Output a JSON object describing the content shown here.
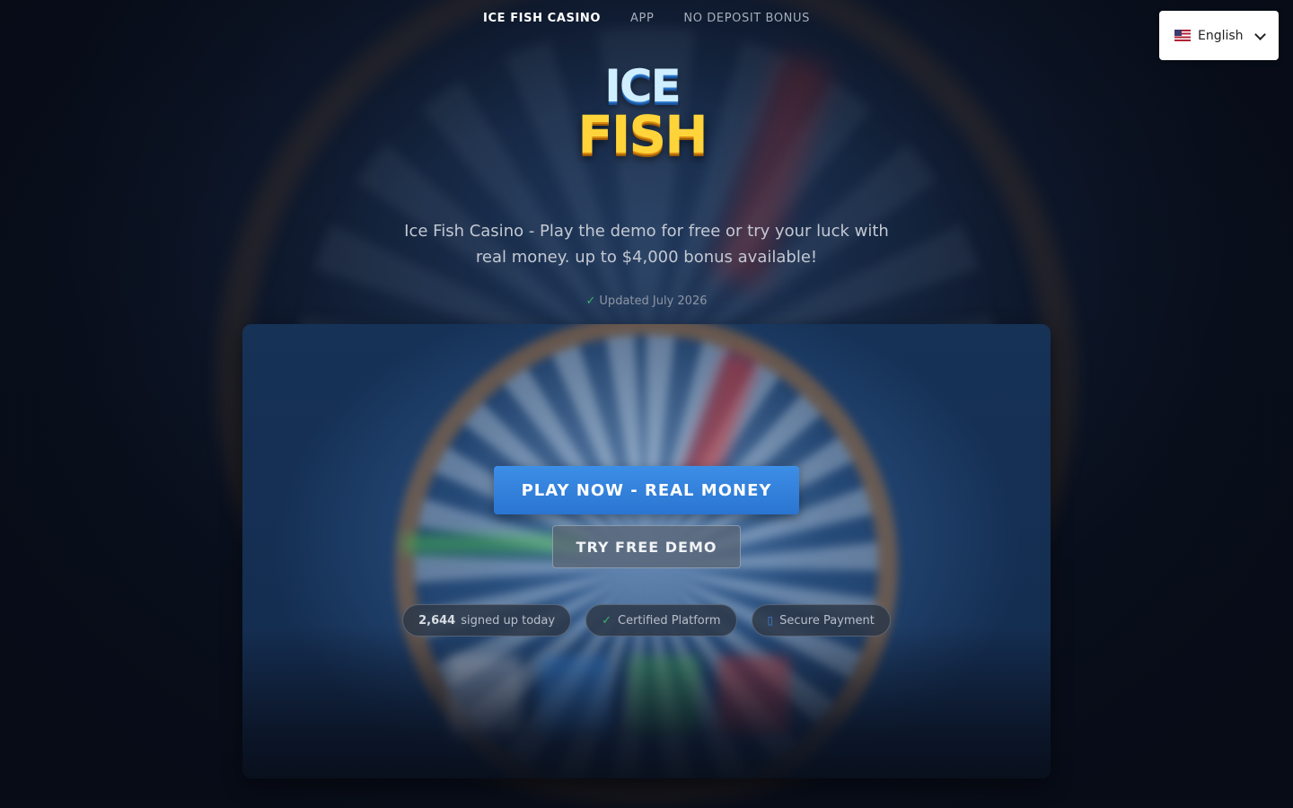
{
  "nav": {
    "items": [
      {
        "label": "ICE FISH CASINO",
        "active": true
      },
      {
        "label": "APP",
        "active": false
      },
      {
        "label": "NO DEPOSIT BONUS",
        "active": false
      }
    ]
  },
  "language": {
    "label": "English",
    "flag_icon": "us-flag-icon"
  },
  "logo": {
    "line1": "ICE",
    "line2": "FISH"
  },
  "subtitle": "Ice Fish Casino - Play the demo for free or try your luck with real money. up to $4,000 bonus available!",
  "updated": {
    "icon": "✓",
    "text": "Updated July 2026"
  },
  "hero": {
    "primary_button": "PLAY NOW - REAL MONEY",
    "secondary_button": "TRY FREE DEMO",
    "badges": {
      "signups": {
        "count": "2,644",
        "text": "signed up today"
      },
      "certified": {
        "icon": "✓",
        "text": "Certified Platform"
      },
      "secure": {
        "icon": "▯",
        "text": "Secure Payment"
      }
    }
  },
  "colors": {
    "background": "#0c1424",
    "primary_button": "#2f7fdb",
    "check_green": "#39b66a",
    "logo_ice": "#cfeeff",
    "logo_fish": "#ffd43a"
  }
}
